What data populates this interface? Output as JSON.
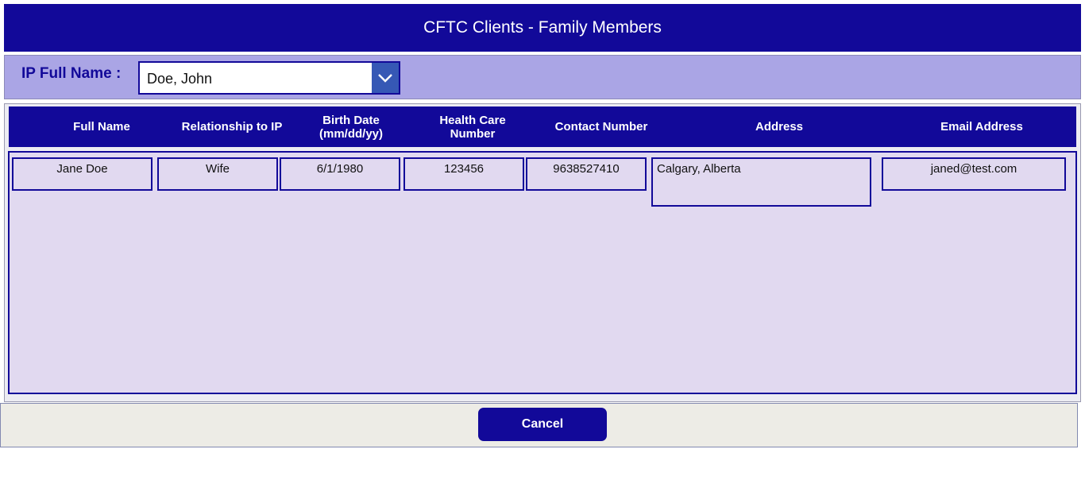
{
  "header": {
    "title": "CFTC Clients - Family Members"
  },
  "filter": {
    "label": "IP Full Name :",
    "selected": "Doe, John"
  },
  "table": {
    "columns": {
      "full_name": "Full Name",
      "relationship": "Relationship to IP",
      "birth_date": "Birth Date (mm/dd/yy)",
      "health_care": "Health Care Number",
      "contact": "Contact Number",
      "address": "Address",
      "email": "Email Address"
    },
    "rows": [
      {
        "full_name": "Jane Doe",
        "relationship": "Wife",
        "birth_date": "6/1/1980",
        "health_care": "123456",
        "contact": "9638527410",
        "address": "Calgary, Alberta",
        "email": "janed@test.com"
      }
    ]
  },
  "footer": {
    "cancel_label": "Cancel"
  },
  "colors": {
    "primary": "#120999",
    "filter_bg": "#AAA5E5",
    "gallery_bg": "#E1D9F0",
    "dropdown_button": "#3658B5",
    "footer_bg": "#EDECE6"
  },
  "icons": {
    "dropdown": "chevron-down-icon"
  }
}
